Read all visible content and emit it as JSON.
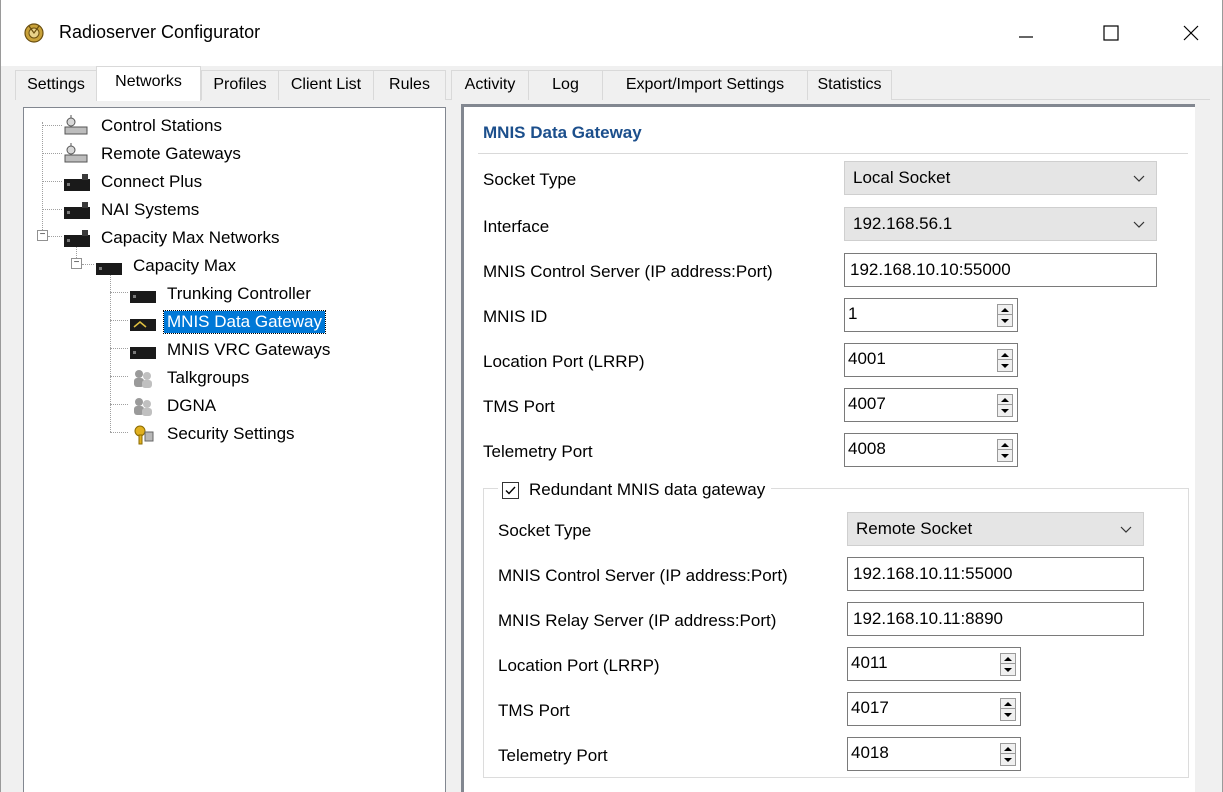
{
  "window": {
    "title": "Radioserver Configurator"
  },
  "tabs": [
    {
      "label": "Settings",
      "active": false
    },
    {
      "label": "Networks",
      "active": true
    },
    {
      "label": "Profiles",
      "active": false
    },
    {
      "label": "Client List",
      "active": false
    },
    {
      "label": "Rules",
      "active": false
    },
    {
      "label": "Activity",
      "active": false
    },
    {
      "label": "Log",
      "active": false
    },
    {
      "label": "Export/Import Settings",
      "active": false
    },
    {
      "label": "Statistics",
      "active": false
    }
  ],
  "tree": {
    "items": [
      {
        "label": "Control Stations",
        "icon": "control-stations-icon"
      },
      {
        "label": "Remote Gateways",
        "icon": "remote-gateways-icon"
      },
      {
        "label": "Connect Plus",
        "icon": "connect-plus-icon"
      },
      {
        "label": "NAI Systems",
        "icon": "nai-systems-icon"
      },
      {
        "label": "Capacity Max Networks",
        "icon": "capacity-max-networks-icon",
        "expanded": true
      },
      {
        "label": "Capacity Max",
        "icon": "capacity-max-icon",
        "expanded": true
      },
      {
        "label": "Trunking Controller",
        "icon": "trunking-controller-icon"
      },
      {
        "label": "MNIS Data Gateway",
        "icon": "mnis-data-gateway-icon",
        "selected": true
      },
      {
        "label": "MNIS VRC Gateways",
        "icon": "mnis-vrc-gateways-icon"
      },
      {
        "label": "Talkgroups",
        "icon": "talkgroups-icon"
      },
      {
        "label": "DGNA",
        "icon": "dgna-icon"
      },
      {
        "label": "Security Settings",
        "icon": "security-settings-icon"
      }
    ]
  },
  "gateway": {
    "title": "MNIS Data Gateway",
    "socket_type_label": "Socket Type",
    "socket_type_value": "Local Socket",
    "interface_label": "Interface",
    "interface_value": "192.168.56.1",
    "control_server_label": "MNIS Control Server (IP address:Port)",
    "control_server_value": "192.168.10.10:55000",
    "mnis_id_label": "MNIS ID",
    "mnis_id_value": "1",
    "location_port_label": "Location Port (LRRP)",
    "location_port_value": "4001",
    "tms_port_label": "TMS Port",
    "tms_port_value": "4007",
    "telemetry_port_label": "Telemetry Port",
    "telemetry_port_value": "4008"
  },
  "redundant": {
    "checkbox_label": "Redundant MNIS data gateway",
    "checked": true,
    "socket_type_label": "Socket Type",
    "socket_type_value": "Remote Socket",
    "control_server_label": "MNIS Control Server (IP address:Port)",
    "control_server_value": "192.168.10.11:55000",
    "relay_server_label": "MNIS Relay Server (IP address:Port)",
    "relay_server_value": "192.168.10.11:8890",
    "location_port_label": "Location Port (LRRP)",
    "location_port_value": "4011",
    "tms_port_label": "TMS Port",
    "tms_port_value": "4017",
    "telemetry_port_label": "Telemetry Port",
    "telemetry_port_value": "4018"
  },
  "colors": {
    "selection": "#0078d7",
    "section_title": "#1c4f8c"
  }
}
